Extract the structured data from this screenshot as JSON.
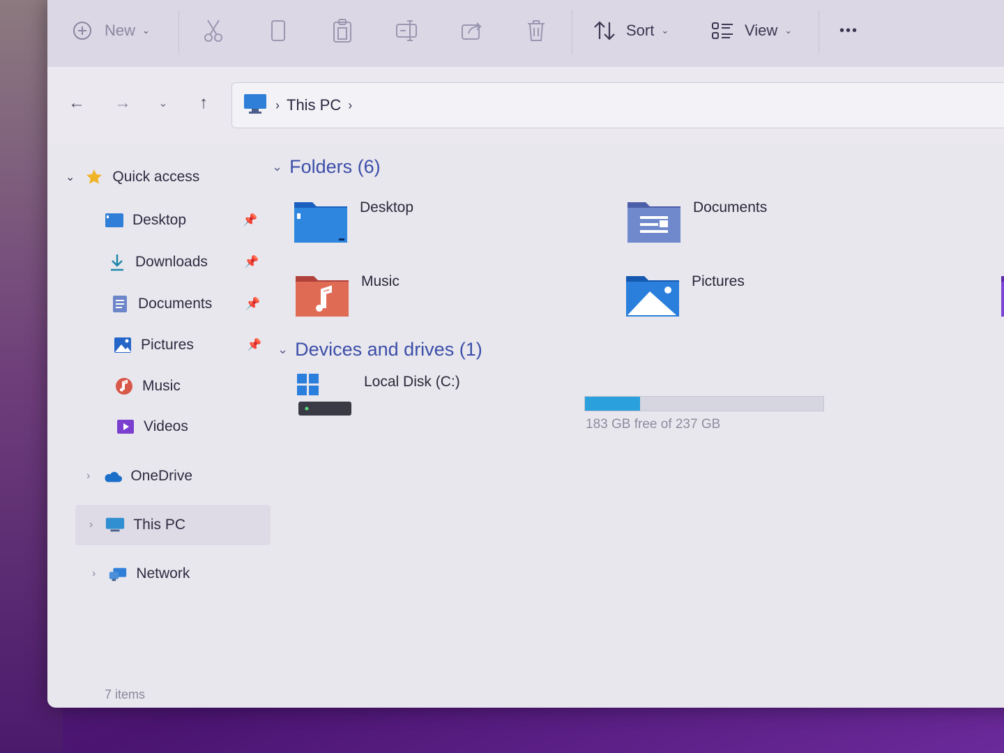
{
  "toolbar": {
    "new_label": "New",
    "sort_label": "Sort",
    "view_label": "View",
    "more_label": "•••"
  },
  "address": {
    "crumbs": [
      "This PC"
    ]
  },
  "sidebar": {
    "quick_access": "Quick access",
    "items": [
      {
        "label": "Desktop",
        "pinned": true
      },
      {
        "label": "Downloads",
        "pinned": true
      },
      {
        "label": "Documents",
        "pinned": true
      },
      {
        "label": "Pictures",
        "pinned": true
      },
      {
        "label": "Music",
        "pinned": false
      },
      {
        "label": "Videos",
        "pinned": false
      }
    ],
    "onedrive": "OneDrive",
    "thispc": "This PC",
    "network": "Network"
  },
  "content": {
    "folders_header": "Folders (6)",
    "folders": [
      "Desktop",
      "Documents",
      "Music",
      "Pictures"
    ],
    "devices_header": "Devices and drives (1)",
    "drive": {
      "name": "Local Disk (C:)",
      "free_text": "183 GB free of 237 GB",
      "used_fraction": 0.23
    }
  },
  "status": {
    "items": "7 items"
  },
  "colors": {
    "accent": "#3b4ea8",
    "drive_fill": "#2aa0dc"
  }
}
